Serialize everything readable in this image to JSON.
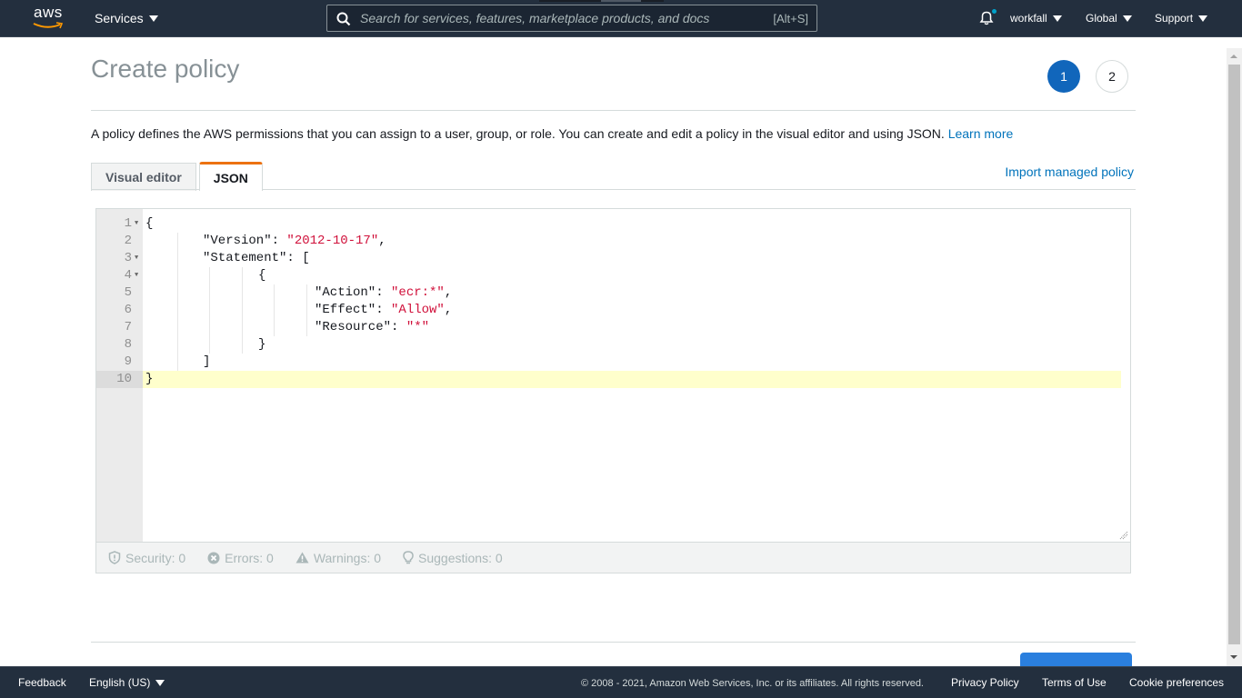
{
  "topnav": {
    "logo_text": "aws",
    "services_label": "Services",
    "search_placeholder": "Search for services, features, marketplace products, and docs",
    "search_shortcut": "[Alt+S]",
    "account_label": "workfall",
    "region_label": "Global",
    "support_label": "Support"
  },
  "page": {
    "title": "Create policy",
    "steps": [
      "1",
      "2"
    ],
    "current_step": 1,
    "description": "A policy defines the AWS permissions that you can assign to a user, group, or role. You can create and edit a policy in the visual editor and using JSON.",
    "learn_more": "Learn more",
    "tabs": [
      {
        "label": "Visual editor",
        "active": false
      },
      {
        "label": "JSON",
        "active": true
      }
    ],
    "import_link": "Import managed policy"
  },
  "editor": {
    "lines": [
      {
        "n": "1",
        "fold": true
      },
      {
        "n": "2",
        "fold": false
      },
      {
        "n": "3",
        "fold": true
      },
      {
        "n": "4",
        "fold": true
      },
      {
        "n": "5",
        "fold": false
      },
      {
        "n": "6",
        "fold": false
      },
      {
        "n": "7",
        "fold": false
      },
      {
        "n": "8",
        "fold": false
      },
      {
        "n": "9",
        "fold": false
      },
      {
        "n": "10",
        "fold": false
      }
    ],
    "tokens": {
      "open_brace": "{",
      "version_key": "\"Version\": ",
      "version_val": "\"2012-10-17\"",
      "statement_key": "\"Statement\": [",
      "obj_open": "{",
      "action_key": "\"Action\": ",
      "action_val": "\"ecr:*\"",
      "effect_key": "\"Effect\": ",
      "effect_val": "\"Allow\"",
      "resource_key": "\"Resource\": ",
      "resource_val": "\"*\"",
      "obj_close": "}",
      "arr_close": "]",
      "close_brace": "}",
      "comma": ","
    },
    "active_line": 10,
    "status": {
      "security": "Security: 0",
      "errors": "Errors: 0",
      "warnings": "Warnings: 0",
      "suggestions": "Suggestions: 0"
    }
  },
  "footer": {
    "feedback": "Feedback",
    "language": "English (US)",
    "copyright": "© 2008 - 2021, Amazon Web Services, Inc. or its affiliates. All rights reserved.",
    "privacy": "Privacy Policy",
    "terms": "Terms of Use",
    "cookies": "Cookie preferences"
  },
  "colors": {
    "nav_bg": "#232f3e",
    "accent_orange": "#ec7211",
    "link_blue": "#0073bb",
    "step_active": "#1166bb",
    "json_string": "#d0103a"
  }
}
